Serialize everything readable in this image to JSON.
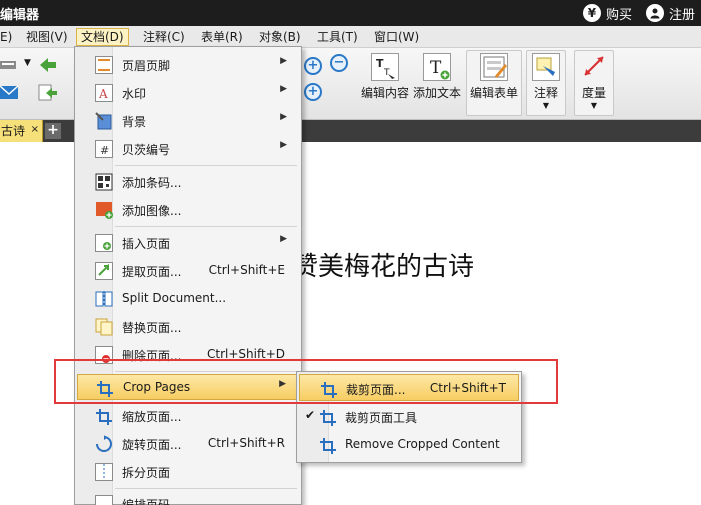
{
  "titlebar": {
    "app_title": "编辑器",
    "buy_icon": "yen-icon",
    "buy_label": "购买",
    "register_icon": "user-icon",
    "register_label": "注册"
  },
  "menubar": {
    "items": [
      "E)",
      "视图(V)",
      "文档(D)",
      "注释(C)",
      "表单(R)",
      "对象(B)",
      "工具(T)",
      "窗口(W)"
    ],
    "active_index": 2
  },
  "ribbon": {
    "buttons": [
      "编辑内容",
      "添加文本",
      "编辑表单",
      "注释",
      "度量"
    ]
  },
  "tabs": {
    "doc_tab": "古诗",
    "close_glyph": "×",
    "add_glyph": "+"
  },
  "document": {
    "title": "赞美梅花的古诗"
  },
  "menu_document": {
    "items": [
      {
        "label": "页眉页脚",
        "shortcut": "",
        "submenu": true
      },
      {
        "label": "水印",
        "shortcut": "",
        "submenu": true
      },
      {
        "label": "背景",
        "shortcut": "",
        "submenu": true
      },
      {
        "label": "贝茨编号",
        "shortcut": "",
        "submenu": true
      },
      {
        "label": "添加条码...",
        "shortcut": "",
        "submenu": false
      },
      {
        "label": "添加图像...",
        "shortcut": "",
        "submenu": false
      },
      {
        "label": "插入页面",
        "shortcut": "",
        "submenu": true
      },
      {
        "label": "提取页面...",
        "shortcut": "Ctrl+Shift+E",
        "submenu": false
      },
      {
        "label": "Split Document...",
        "shortcut": "",
        "submenu": false
      },
      {
        "label": "替换页面...",
        "shortcut": "",
        "submenu": false
      },
      {
        "label": "删除页面...",
        "shortcut": "Ctrl+Shift+D",
        "submenu": false
      },
      {
        "label": "Crop Pages",
        "shortcut": "",
        "submenu": true
      },
      {
        "label": "缩放页面...",
        "shortcut": "",
        "submenu": false
      },
      {
        "label": "旋转页面...",
        "shortcut": "Ctrl+Shift+R",
        "submenu": false
      },
      {
        "label": "拆分页面",
        "shortcut": "",
        "submenu": false
      },
      {
        "label": "编排页码",
        "shortcut": "",
        "submenu": false
      }
    ],
    "highlighted_index": 11
  },
  "submenu_crop": {
    "items": [
      {
        "label": "裁剪页面...",
        "shortcut": "Ctrl+Shift+T",
        "checked": false
      },
      {
        "label": "裁剪页面工具",
        "shortcut": "",
        "checked": true
      },
      {
        "label": "Remove Cropped Content",
        "shortcut": "",
        "checked": false
      }
    ],
    "highlighted_index": 0
  },
  "colors": {
    "titlebar": "#1d1d1d",
    "menu_highlight": "#f7cd62",
    "annotation_outline": "#e23a3a",
    "doc_tab": "#f5e07a"
  }
}
